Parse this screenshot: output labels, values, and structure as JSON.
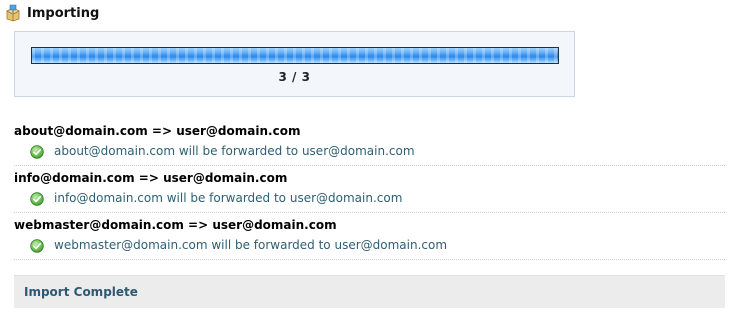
{
  "header": {
    "title": "Importing",
    "icon": "import-box-icon"
  },
  "progress": {
    "fraction": 1.0,
    "text": "3 / 3",
    "color": "#3a8fe8"
  },
  "results": [
    {
      "title": "about@domain.com => user@domain.com",
      "message": "about@domain.com will be forwarded to user@domain.com",
      "status": "success",
      "icon": "check-icon"
    },
    {
      "title": "info@domain.com => user@domain.com",
      "message": "info@domain.com will be forwarded to user@domain.com",
      "status": "success",
      "icon": "check-icon"
    },
    {
      "title": "webmaster@domain.com => user@domain.com",
      "message": "webmaster@domain.com will be forwarded to user@domain.com",
      "status": "success",
      "icon": "check-icon"
    }
  ],
  "footer": {
    "status": "Import Complete"
  }
}
